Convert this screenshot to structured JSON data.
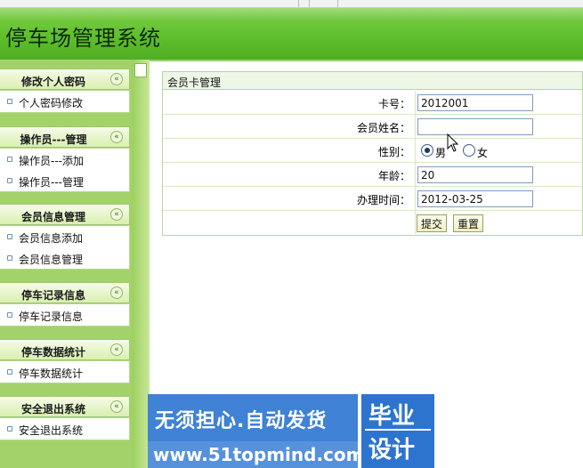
{
  "app": {
    "title": "停车场管理系统"
  },
  "sidebar": {
    "groups": [
      {
        "title": "修改个人密码",
        "items": [
          "个人密码修改"
        ]
      },
      {
        "title": "操作员---管理",
        "items": [
          "操作员---添加",
          "操作员---管理"
        ]
      },
      {
        "title": "会员信息管理",
        "items": [
          "会员信息添加",
          "会员信息管理"
        ]
      },
      {
        "title": "停车记录信息",
        "items": [
          "停车记录信息"
        ]
      },
      {
        "title": "停车数据统计",
        "items": [
          "停车数据统计"
        ]
      },
      {
        "title": "安全退出系统",
        "items": [
          "安全退出系统"
        ]
      }
    ],
    "collapse_glyph": "«"
  },
  "form": {
    "title": "会员卡管理",
    "card_no": {
      "label": "卡号：",
      "value": "2012001"
    },
    "name": {
      "label": "会员姓名：",
      "value": ""
    },
    "gender": {
      "label": "性别：",
      "options": [
        "男",
        "女"
      ],
      "selected": "男"
    },
    "age": {
      "label": "年龄：",
      "value": "20"
    },
    "date": {
      "label": "办理时间：",
      "value": "2012-03-25"
    },
    "submit_label": "提交",
    "reset_label": "重置"
  },
  "banner": {
    "line1": "无须担心.自动发货",
    "line2": "www.51topmind.com",
    "tag_top": "毕业",
    "tag_bottom": "设计"
  },
  "colors": {
    "header": "#5fbf2d",
    "menu_bg": "#a4d26a",
    "banner": "#3f82d6"
  }
}
